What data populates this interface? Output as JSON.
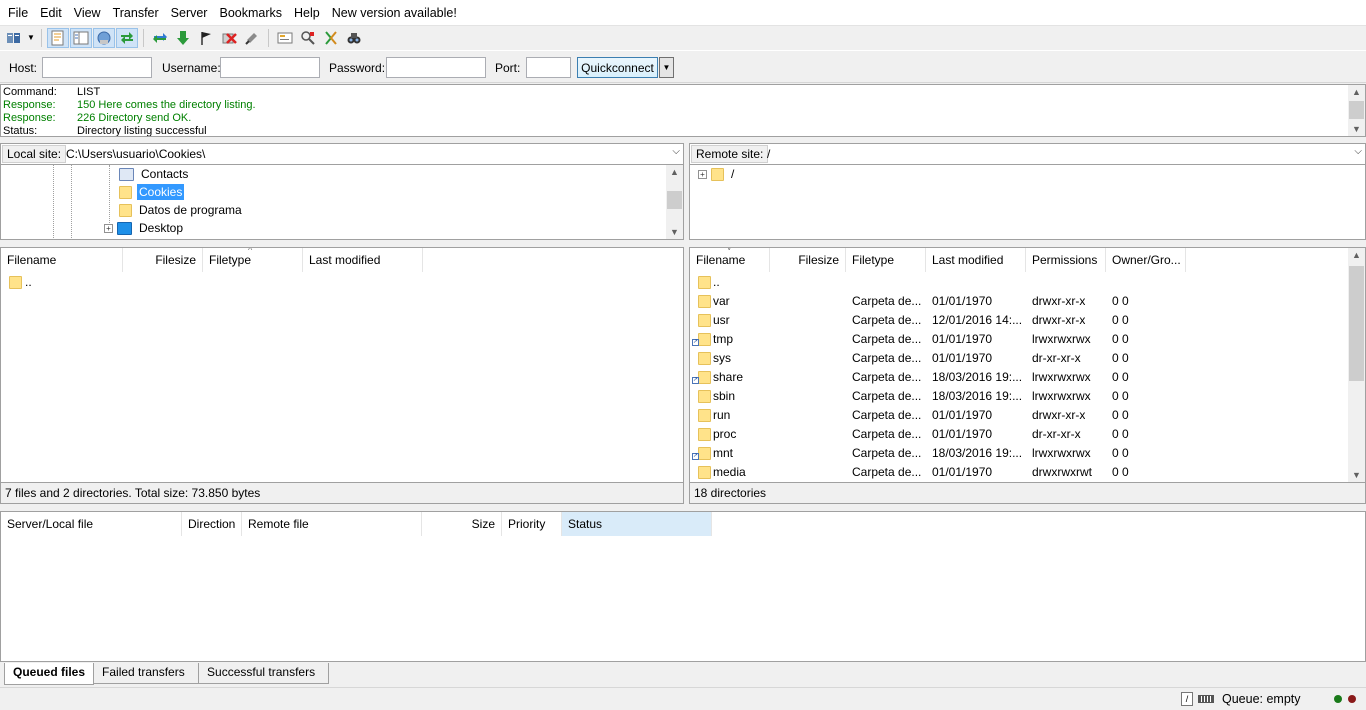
{
  "menu": [
    "File",
    "Edit",
    "View",
    "Transfer",
    "Server",
    "Bookmarks",
    "Help",
    "New version available!"
  ],
  "toolbar": {
    "icons": [
      "site-manager-icon",
      "toggle-log-icon",
      "toggle-local-tree-icon",
      "toggle-remote-tree-icon",
      "toggle-queue-icon",
      "refresh-icon",
      "process-queue-icon",
      "cancel-operation-icon",
      "disconnect-icon",
      "reconnect-icon",
      "directory-listing-filters-icon",
      "toggle-sync-browsing-icon",
      "compare-directories-icon",
      "search-remote-icon"
    ]
  },
  "quickconnect": {
    "host_label": "Host:",
    "username_label": "Username:",
    "password_label": "Password:",
    "port_label": "Port:",
    "host_value": "",
    "username_value": "",
    "password_value": "",
    "port_value": "",
    "button_label": "Quickconnect",
    "dropdown_glyph": "▼"
  },
  "log": [
    {
      "key": "Command:",
      "value": "LIST",
      "color": "#000000"
    },
    {
      "key": "Response:",
      "value": "150 Here comes the directory listing.",
      "color": "#008000"
    },
    {
      "key": "Response:",
      "value": "226 Directory send OK.",
      "color": "#008000"
    },
    {
      "key": "Status:",
      "value": "Directory listing successful",
      "color": "#000000"
    }
  ],
  "local": {
    "site_label": "Local site:",
    "path": "C:\\Users\\usuario\\Cookies\\",
    "tree": [
      {
        "label": "Contacts",
        "icon": "contacts-folder-icon",
        "selected": false
      },
      {
        "label": "Cookies",
        "icon": "folder-icon",
        "selected": true
      },
      {
        "label": "Datos de programa",
        "icon": "folder-icon",
        "selected": false
      },
      {
        "label": "Desktop",
        "icon": "desktop-icon",
        "selected": false,
        "expander": "+"
      }
    ],
    "columns": [
      "Filename",
      "Filesize",
      "Filetype",
      "Last modified"
    ],
    "rows": [
      {
        "name": ".."
      }
    ],
    "status": "7 files and 2 directories. Total size: 73.850 bytes"
  },
  "remote": {
    "site_label": "Remote site:",
    "path": "/",
    "tree": [
      {
        "label": "/",
        "expander": "+"
      }
    ],
    "columns": [
      "Filename",
      "Filesize",
      "Filetype",
      "Last modified",
      "Permissions",
      "Owner/Gro..."
    ],
    "rows": [
      {
        "name": "..",
        "type": "",
        "modified": "",
        "perms": "",
        "owner": "",
        "link": false
      },
      {
        "name": "var",
        "type": "Carpeta de...",
        "modified": "01/01/1970",
        "perms": "drwxr-xr-x",
        "owner": "0 0",
        "link": false
      },
      {
        "name": "usr",
        "type": "Carpeta de...",
        "modified": "12/01/2016 14:...",
        "perms": "drwxr-xr-x",
        "owner": "0 0",
        "link": false
      },
      {
        "name": "tmp",
        "type": "Carpeta de...",
        "modified": "01/01/1970",
        "perms": "lrwxrwxrwx",
        "owner": "0 0",
        "link": true
      },
      {
        "name": "sys",
        "type": "Carpeta de...",
        "modified": "01/01/1970",
        "perms": "dr-xr-xr-x",
        "owner": "0 0",
        "link": false
      },
      {
        "name": "share",
        "type": "Carpeta de...",
        "modified": "18/03/2016 19:...",
        "perms": "lrwxrwxrwx",
        "owner": "0 0",
        "link": true
      },
      {
        "name": "sbin",
        "type": "Carpeta de...",
        "modified": "18/03/2016 19:...",
        "perms": "lrwxrwxrwx",
        "owner": "0 0",
        "link": false
      },
      {
        "name": "run",
        "type": "Carpeta de...",
        "modified": "01/01/1970",
        "perms": "drwxr-xr-x",
        "owner": "0 0",
        "link": false
      },
      {
        "name": "proc",
        "type": "Carpeta de...",
        "modified": "01/01/1970",
        "perms": "dr-xr-xr-x",
        "owner": "0 0",
        "link": false
      },
      {
        "name": "mnt",
        "type": "Carpeta de...",
        "modified": "18/03/2016 19:...",
        "perms": "lrwxrwxrwx",
        "owner": "0 0",
        "link": true
      },
      {
        "name": "media",
        "type": "Carpeta de...",
        "modified": "01/01/1970",
        "perms": "drwxrwxrwt",
        "owner": "0 0",
        "link": false
      }
    ],
    "status": "18 directories"
  },
  "queue": {
    "columns": [
      "Server/Local file",
      "Direction",
      "Remote file",
      "Size",
      "Priority",
      "Status"
    ],
    "tabs": [
      {
        "label": "Queued files",
        "active": true
      },
      {
        "label": "Failed transfers",
        "active": false
      },
      {
        "label": "Successful transfers",
        "active": false
      }
    ]
  },
  "statusbar": {
    "queue_text": "Queue: empty",
    "led_colors": [
      "#1a7a1a",
      "#8a1a1a"
    ]
  },
  "colors": {
    "selection": "#3399ff",
    "log_green": "#008000",
    "folder": "#ffe38a"
  }
}
